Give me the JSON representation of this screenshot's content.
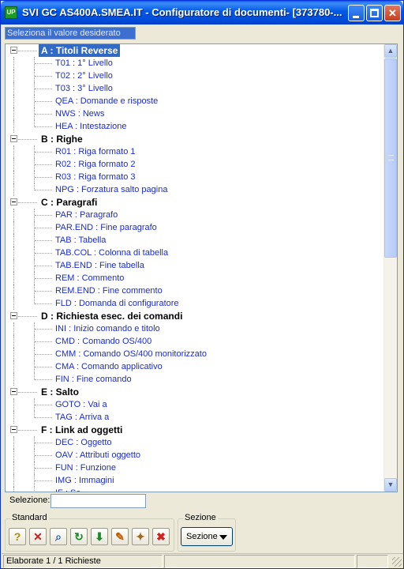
{
  "window": {
    "app_icon_text": "UP",
    "title": "SVI GC AS400A.SMEA.IT - Configuratore di documenti- [373780-..."
  },
  "prompt": "Seleziona il valore desiderato",
  "tree": [
    {
      "code": "A",
      "label": "A : Titoli Reverse",
      "selected": true,
      "children": [
        "T01 : 1° Livello",
        "T02 : 2° Livello",
        "T03 : 3° Livello",
        "QEA : Domande e risposte",
        "NWS : News",
        "HEA : Intestazione"
      ]
    },
    {
      "code": "B",
      "label": "B : Righe",
      "children": [
        "R01 : Riga formato 1",
        "R02 : Riga formato 2",
        "R03 : Riga formato 3",
        "NPG : Forzatura salto pagina"
      ]
    },
    {
      "code": "C",
      "label": "C : Paragrafi",
      "children": [
        "PAR : Paragrafo",
        "PAR.END : Fine paragrafo",
        "TAB : Tabella",
        "TAB.COL : Colonna di tabella",
        "TAB.END : Fine tabella",
        "REM : Commento",
        "REM.END : Fine commento",
        "FLD : Domanda di configuratore"
      ]
    },
    {
      "code": "D",
      "label": "D : Richiesta esec. dei comandi",
      "children": [
        "INI : Inizio comando e titolo",
        "CMD : Comando OS/400",
        "CMM : Comando OS/400 monitorizzato",
        "CMA : Comando applicativo",
        "FIN : Fine comando"
      ]
    },
    {
      "code": "E",
      "label": "E : Salto",
      "children": [
        "GOTO : Vai a",
        "TAG : Arriva a"
      ]
    },
    {
      "code": "F",
      "label": "F : Link ad oggetti",
      "children": [
        "DEC : Oggetto",
        "OAV : Attributi oggetto",
        "FUN : Funzione",
        "IMG : Immagini",
        "IF : Se"
      ]
    }
  ],
  "selection": {
    "label": "Selezione:",
    "value": ""
  },
  "toolbar": {
    "standard_label": "Standard",
    "sezione_group_label": "Sezione",
    "sezione_button_label": "Sezione",
    "tools": [
      {
        "name": "help-icon",
        "glyph": "?",
        "color": "#b58a00"
      },
      {
        "name": "cancel-icon",
        "glyph": "✕",
        "color": "#c81e1e"
      },
      {
        "name": "search-icon",
        "glyph": "⌕",
        "color": "#2a5db0"
      },
      {
        "name": "refresh-icon",
        "glyph": "↻",
        "color": "#1b8a2a"
      },
      {
        "name": "confirm-arrow-icon",
        "glyph": "⬇",
        "color": "#1b8a2a"
      },
      {
        "name": "edit-document-icon",
        "glyph": "✎",
        "color": "#c05a00"
      },
      {
        "name": "magic-wand-icon",
        "glyph": "✦",
        "color": "#a06a20"
      },
      {
        "name": "exit-icon",
        "glyph": "✖",
        "color": "#d42020"
      }
    ]
  },
  "status": {
    "text": "Elaborate 1 / 1 Richieste",
    "pane2": "",
    "pane3": ""
  }
}
